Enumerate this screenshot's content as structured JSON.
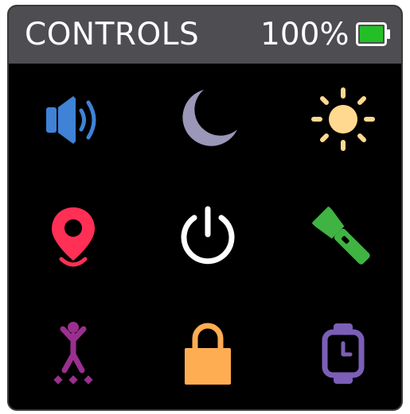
{
  "header": {
    "title": "CONTROLS",
    "battery_text": "100%",
    "battery_level": 1.0
  },
  "controls": [
    {
      "name": "volume",
      "icon": "speaker-icon",
      "color": "#3f82d6"
    },
    {
      "name": "do-not-disturb",
      "icon": "moon-icon",
      "color": "#9a97b8"
    },
    {
      "name": "brightness",
      "icon": "sun-icon",
      "color": "#ffd98f"
    },
    {
      "name": "location",
      "icon": "map-pin-icon",
      "color": "#ff2f55"
    },
    {
      "name": "power",
      "icon": "power-icon",
      "color": "#ffffff"
    },
    {
      "name": "flashlight",
      "icon": "flashlight-icon",
      "color": "#3fb443"
    },
    {
      "name": "activity",
      "icon": "person-activity-icon",
      "color": "#9b2f8f"
    },
    {
      "name": "lock",
      "icon": "lock-icon",
      "color": "#ffad52"
    },
    {
      "name": "watch-face",
      "icon": "watch-icon",
      "color": "#7b5fb7"
    }
  ],
  "colors": {
    "header_bg": "#4d4d52",
    "screen_bg": "#000000",
    "battery_green": "#22c026"
  }
}
